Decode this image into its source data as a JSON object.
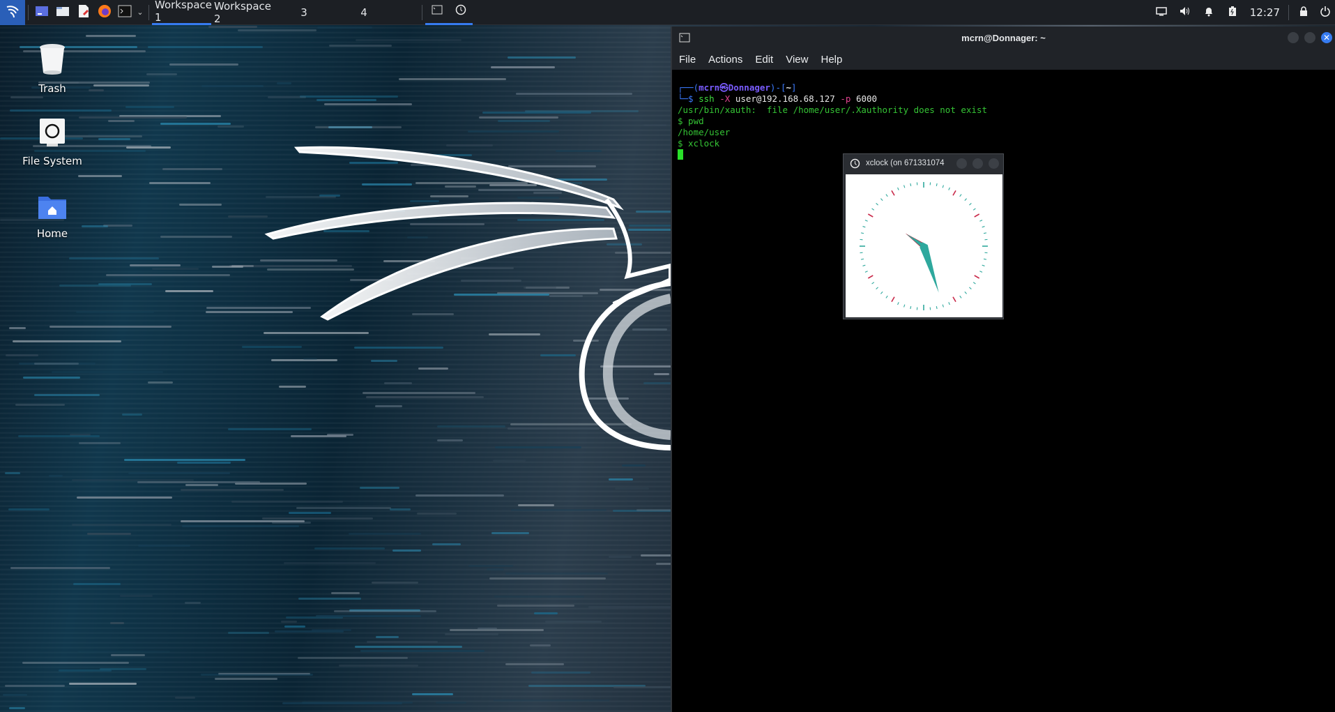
{
  "taskbar": {
    "workspaces": [
      "Workspace 1",
      "Workspace 2",
      "3",
      "4"
    ],
    "active_workspace": 0,
    "launchers": [
      "kali-menu-icon",
      "show-desktop-icon",
      "file-manager-icon",
      "text-editor-icon",
      "firefox-icon",
      "terminal-icon"
    ],
    "tray_icons": [
      "display-icon",
      "volume-icon",
      "notification-bell-icon",
      "battery-icon"
    ],
    "clock": "12:27",
    "lock_icon": "lock-icon",
    "power_icon": "power-icon",
    "accent": "#367bf0"
  },
  "desktop": {
    "icons": [
      {
        "label": "Trash",
        "icon": "trash-icon"
      },
      {
        "label": "File System",
        "icon": "drive-icon"
      },
      {
        "label": "Home",
        "icon": "home-folder-icon"
      }
    ]
  },
  "terminal": {
    "title": "mcrn@Donnager: ~",
    "menu": [
      "File",
      "Actions",
      "Edit",
      "View",
      "Help"
    ],
    "prompt": {
      "box_prefix": "┌──(",
      "user_host": "mcrn㉿Donnager",
      "mid": ")-[",
      "cwd": "~",
      "suffix": "]",
      "line2_prefix": "└─$ "
    },
    "command": {
      "ssh": "ssh",
      "flag_x": "-X",
      "target": "user@192.168.68.127",
      "flag_p": "-p",
      "port": "6000"
    },
    "output": [
      "/usr/bin/xauth:  file /home/user/.Xauthority does not exist",
      "$ pwd",
      "/home/user",
      "$ xclock"
    ]
  },
  "xclock": {
    "title": "xclock (on 671331074",
    "hands_color": "#2ea89d",
    "hand_dark_color": "#b8273b",
    "tick_color": "#2ea89d",
    "hour_tick_color": "#c92a4a"
  }
}
